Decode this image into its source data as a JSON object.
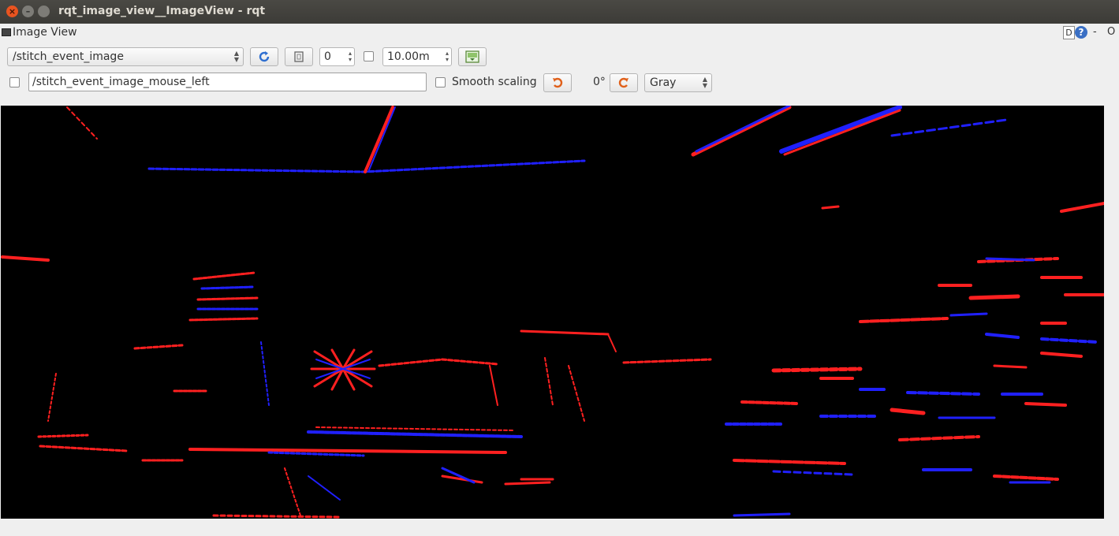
{
  "window": {
    "title": "rqt_image_view__ImageView - rqt"
  },
  "plugin": {
    "title": "Image View",
    "help_d": "D",
    "help_q": "?",
    "minimize": "-",
    "close": "O"
  },
  "toolbar": {
    "topic": "/stitch_event_image",
    "refresh_icon": "refresh-icon",
    "zoom_spin_value": "0",
    "duration_checkbox_checked": false,
    "duration_value": "10.00m",
    "save_icon": "save-image-icon"
  },
  "toolbar2": {
    "mouse_checkbox_checked": false,
    "mouse_topic": "/stitch_event_image_mouse_left",
    "smooth_scaling_checked": false,
    "smooth_scaling_label": "Smooth scaling",
    "rotate_left_icon": "rotate-left-icon",
    "rotation": "0°",
    "rotate_right_icon": "rotate-right-icon",
    "color_scheme": "Gray"
  },
  "colors": {
    "positive_event": "#ff2020",
    "negative_event": "#2020ff",
    "background": "#000000"
  }
}
